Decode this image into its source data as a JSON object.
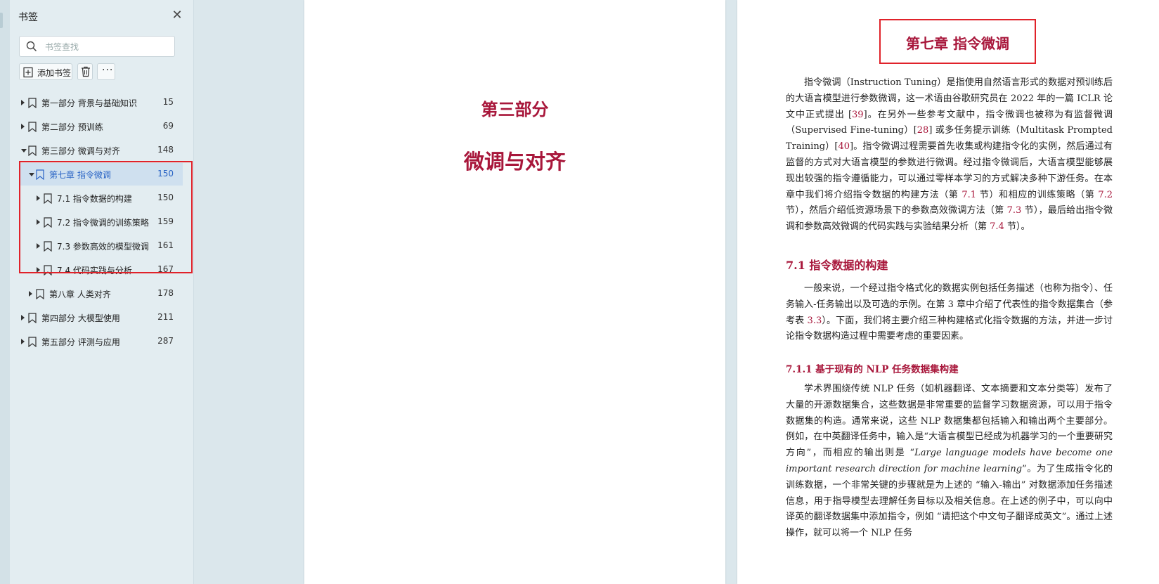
{
  "sidebar": {
    "title": "书签",
    "close_icon": "close-icon",
    "search": {
      "placeholder": "书签查找",
      "value": ""
    },
    "toolbar": {
      "add_label": "添加书签",
      "delete_icon": "trash-icon",
      "more_label": "···"
    },
    "bookmarks": [
      {
        "label": "第一部分 背景与基础知识",
        "page": "15",
        "level": 0,
        "expanded": false,
        "selected": false
      },
      {
        "label": "第二部分 预训练",
        "page": "69",
        "level": 0,
        "expanded": false,
        "selected": false
      },
      {
        "label": "第三部分 微调与对齐",
        "page": "148",
        "level": 0,
        "expanded": true,
        "selected": false
      },
      {
        "label": "第七章 指令微调",
        "page": "150",
        "level": 1,
        "expanded": true,
        "selected": true
      },
      {
        "label": "7.1 指令数据的构建",
        "page": "150",
        "level": 2,
        "expanded": false,
        "selected": false
      },
      {
        "label": "7.2 指令微调的训练策略",
        "page": "159",
        "level": 2,
        "expanded": false,
        "selected": false
      },
      {
        "label": "7.3 参数高效的模型微调",
        "page": "161",
        "level": 2,
        "expanded": false,
        "selected": false
      },
      {
        "label": "7.4 代码实践与分析",
        "page": "167",
        "level": 2,
        "expanded": false,
        "selected": false
      },
      {
        "label": "第八章 人类对齐",
        "page": "178",
        "level": 1,
        "expanded": false,
        "selected": false
      },
      {
        "label": "第四部分 大模型使用",
        "page": "211",
        "level": 0,
        "expanded": false,
        "selected": false
      },
      {
        "label": "第五部分 评测与应用",
        "page": "287",
        "level": 0,
        "expanded": false,
        "selected": false
      }
    ]
  },
  "left_page": {
    "part_number": "第三部分",
    "part_name": "微调与对齐"
  },
  "right_page": {
    "chapter_title": "第七章 指令微调",
    "intro_paragraph": [
      {
        "t": "指令微调（Instruction Tuning）是指使用自然语言形式的数据对预训练后的大语言模型进行参数微调，这一术语由谷歌研究员在 2022 年的一篇 ICLR 论文中正式提出 ["
      },
      {
        "t": "39",
        "ref": true
      },
      {
        "t": "]。在另外一些参考文献中，指令微调也被称为有监督微调（Supervised Fine-tuning）["
      },
      {
        "t": "28",
        "ref": true
      },
      {
        "t": "] 或多任务提示训练（Multitask Prompted Training）["
      },
      {
        "t": "40",
        "ref": true
      },
      {
        "t": "]。指令微调过程需要首先收集或构建指令化的实例，然后通过有监督的方式对大语言模型的参数进行微调。经过指令微调后，大语言模型能够展现出较强的指令遵循能力，可以通过零样本学习的方式解决多种下游任务。在本章中我们将介绍指令数据的构建方法（第 "
      },
      {
        "t": "7.1",
        "ref": true
      },
      {
        "t": " 节）和相应的训练策略（第 "
      },
      {
        "t": "7.2",
        "ref": true
      },
      {
        "t": " 节），然后介绍低资源场景下的参数高效微调方法（第 "
      },
      {
        "t": "7.3",
        "ref": true
      },
      {
        "t": " 节），最后给出指令微调和参数高效微调的代码实践与实验结果分析（第 "
      },
      {
        "t": "7.4",
        "ref": true
      },
      {
        "t": " 节）。"
      }
    ],
    "section_71_title": "7.1  指令数据的构建",
    "section_71_paragraph": [
      {
        "t": "一般来说，一个经过指令格式化的数据实例包括任务描述（也称为指令）、任务输入-任务输出以及可选的示例。在第 3 章中介绍了代表性的指令数据集合（参考表 "
      },
      {
        "t": "3.3",
        "ref": true
      },
      {
        "t": "）。下面，我们将主要介绍三种构建格式化指令数据的方法，并进一步讨论指令数据构造过程中需要考虑的重要因素。"
      }
    ],
    "section_711_title": "7.1.1  基于现有的 NLP 任务数据集构建",
    "section_711_paragraph": [
      {
        "t": "学术界围绕传统 NLP 任务（如机器翻译、文本摘要和文本分类等）发布了大量的开源数据集合，这些数据是非常重要的监督学习数据资源，可以用于指令数据集的构造。通常来说，这些 NLP 数据集都包括输入和输出两个主要部分。例如，在中英翻译任务中，输入是“大语言模型已经成为机器学习的一个重要研究方向”，而相应的输出则是 “"
      },
      {
        "t": "Large language models have become one important research direction for machine learning",
        "italic": true
      },
      {
        "t": "”。为了生成指令化的训练数据，一个非常关键的步骤就是为上述的 “输入-输出” 对数据添加任务描述信息，用于指导模型去理解任务目标以及相关信息。在上述的例子中，可以向中译英的翻译数据集中添加指令，例如 “请把这个中文句子翻译成英文”。通过上述操作，就可以将一个 NLP 任务"
      }
    ]
  }
}
